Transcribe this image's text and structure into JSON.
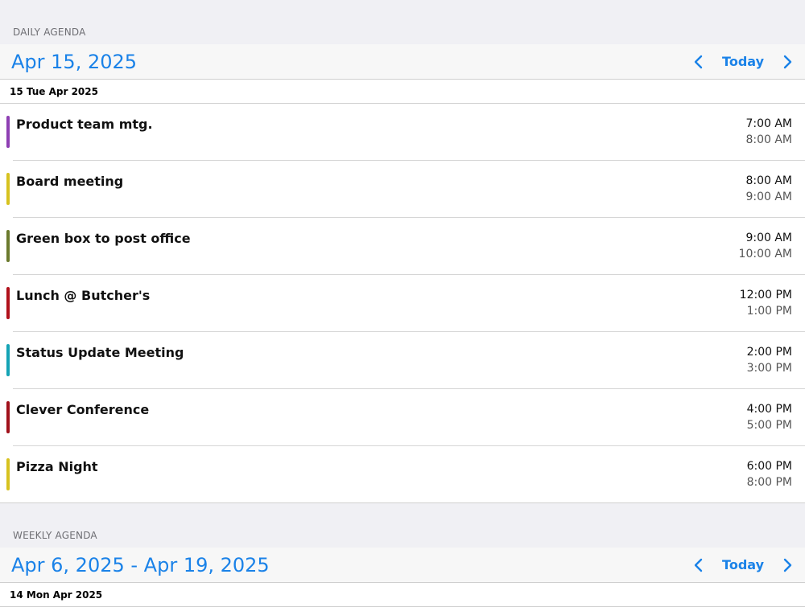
{
  "daily": {
    "section_label": "DAILY AGENDA",
    "header_title": "Apr 15, 2025",
    "today_label": "Today",
    "day_header": "15 Tue Apr 2025",
    "events": [
      {
        "title": "Product team mtg.",
        "start": "7:00 AM",
        "end": "8:00 AM",
        "color": "#8e3fb3"
      },
      {
        "title": "Board meeting",
        "start": "8:00 AM",
        "end": "9:00 AM",
        "color": "#d7c21f"
      },
      {
        "title": "Green box to post office",
        "start": "9:00 AM",
        "end": "10:00 AM",
        "color": "#6b7a2d"
      },
      {
        "title": "Lunch @ Butcher's",
        "start": "12:00 PM",
        "end": "1:00 PM",
        "color": "#b0101a"
      },
      {
        "title": "Status Update Meeting",
        "start": "2:00 PM",
        "end": "3:00 PM",
        "color": "#14a3b5"
      },
      {
        "title": "Clever Conference",
        "start": "4:00 PM",
        "end": "5:00 PM",
        "color": "#a0101a"
      },
      {
        "title": "Pizza Night",
        "start": "6:00 PM",
        "end": "8:00 PM",
        "color": "#d7c21f"
      }
    ]
  },
  "weekly": {
    "section_label": "WEEKLY AGENDA",
    "header_title": "Apr 6, 2025 - Apr 19, 2025",
    "today_label": "Today",
    "day_header": "14 Mon Apr 2025"
  },
  "colors": {
    "accent": "#1a82e8",
    "background": "#f0f0f4"
  },
  "icons": {
    "prev": "chevron-left-icon",
    "next": "chevron-right-icon"
  }
}
